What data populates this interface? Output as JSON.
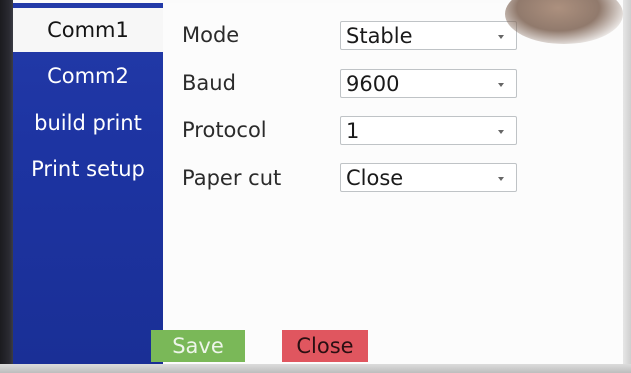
{
  "sidebar": {
    "items": [
      {
        "label": "Comm1",
        "active": true
      },
      {
        "label": "Comm2",
        "active": false
      },
      {
        "label": "build print",
        "active": false
      },
      {
        "label": "Print setup",
        "active": false
      }
    ]
  },
  "form": {
    "fields": [
      {
        "label": "Mode",
        "value": "Stable"
      },
      {
        "label": "Baud",
        "value": "9600"
      },
      {
        "label": "Protocol",
        "value": "1"
      },
      {
        "label": "Paper cut",
        "value": "Close"
      }
    ]
  },
  "buttons": {
    "save": "Save",
    "close": "Close"
  },
  "colors": {
    "sidebar": "#1d34a2",
    "save": "#7ab858",
    "close": "#e0565f"
  }
}
